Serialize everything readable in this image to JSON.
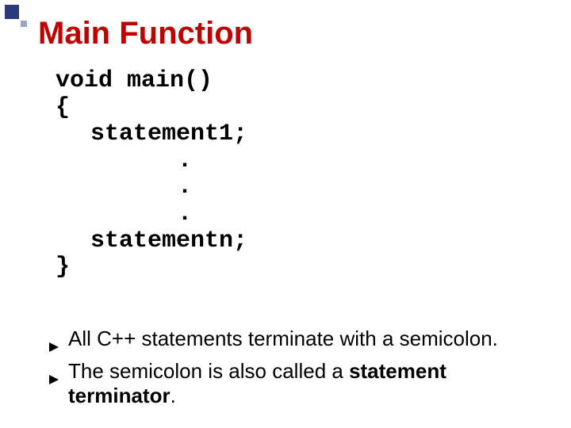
{
  "title": "Main Function",
  "code": {
    "l1": "void main()",
    "l2": "{",
    "l3": "statement1;",
    "dot": ".",
    "l4": "statementn;",
    "l5": "}"
  },
  "bullets": {
    "b1": "All C++ statements terminate with a semicolon.",
    "b2_a": "The semicolon is also called a ",
    "b2_b": "statement terminator",
    "b2_c": "."
  }
}
